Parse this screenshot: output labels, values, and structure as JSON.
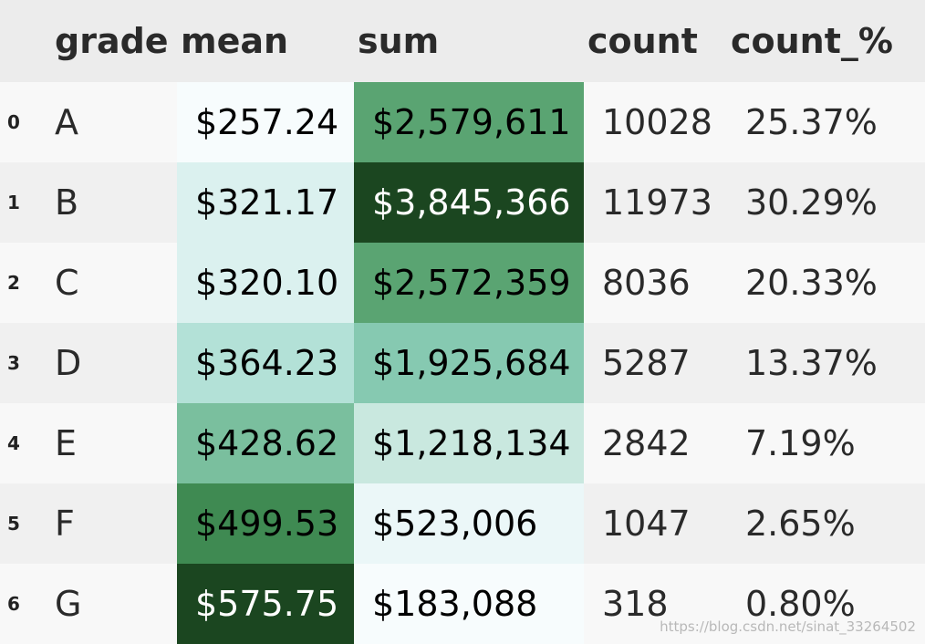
{
  "table": {
    "headers": [
      "",
      "grade",
      "mean",
      "sum",
      "count",
      "count_%"
    ],
    "rows": [
      {
        "index": "0",
        "grade": "A",
        "mean": "$257.24",
        "sum": "$2,579,611",
        "count": "10028",
        "count_pct": "25.37%"
      },
      {
        "index": "1",
        "grade": "B",
        "mean": "$321.17",
        "sum": "$3,845,366",
        "count": "11973",
        "count_pct": "30.29%"
      },
      {
        "index": "2",
        "grade": "C",
        "mean": "$320.10",
        "sum": "$2,572,359",
        "count": "8036",
        "count_pct": "20.33%"
      },
      {
        "index": "3",
        "grade": "D",
        "mean": "$364.23",
        "sum": "$1,925,684",
        "count": "5287",
        "count_pct": "13.37%"
      },
      {
        "index": "4",
        "grade": "E",
        "mean": "$428.62",
        "sum": "$1,218,134",
        "count": "2842",
        "count_pct": "7.19%"
      },
      {
        "index": "5",
        "grade": "F",
        "mean": "$499.53",
        "sum": "$523,006",
        "count": "1047",
        "count_pct": "2.65%"
      },
      {
        "index": "6",
        "grade": "G",
        "mean": "$575.75",
        "sum": "$183,088",
        "count": "318",
        "count_pct": "0.80%"
      }
    ],
    "mean_colors": [
      "#f7fcfd",
      "#dbf1ef",
      "#dbf1ef",
      "#b3e1d7",
      "#7abf9e",
      "#3f8a52",
      "#1b4620"
    ],
    "sum_colors": [
      "#5aa472",
      "#1b4620",
      "#5aa472",
      "#86c9b1",
      "#c9e8df",
      "#ebf7f8",
      "#f7fcfd"
    ],
    "mean_dark": [
      false,
      false,
      false,
      false,
      false,
      false,
      true
    ],
    "sum_dark": [
      false,
      true,
      false,
      false,
      false,
      false,
      false
    ]
  },
  "watermark": "https://blog.csdn.net/sinat_33264502"
}
